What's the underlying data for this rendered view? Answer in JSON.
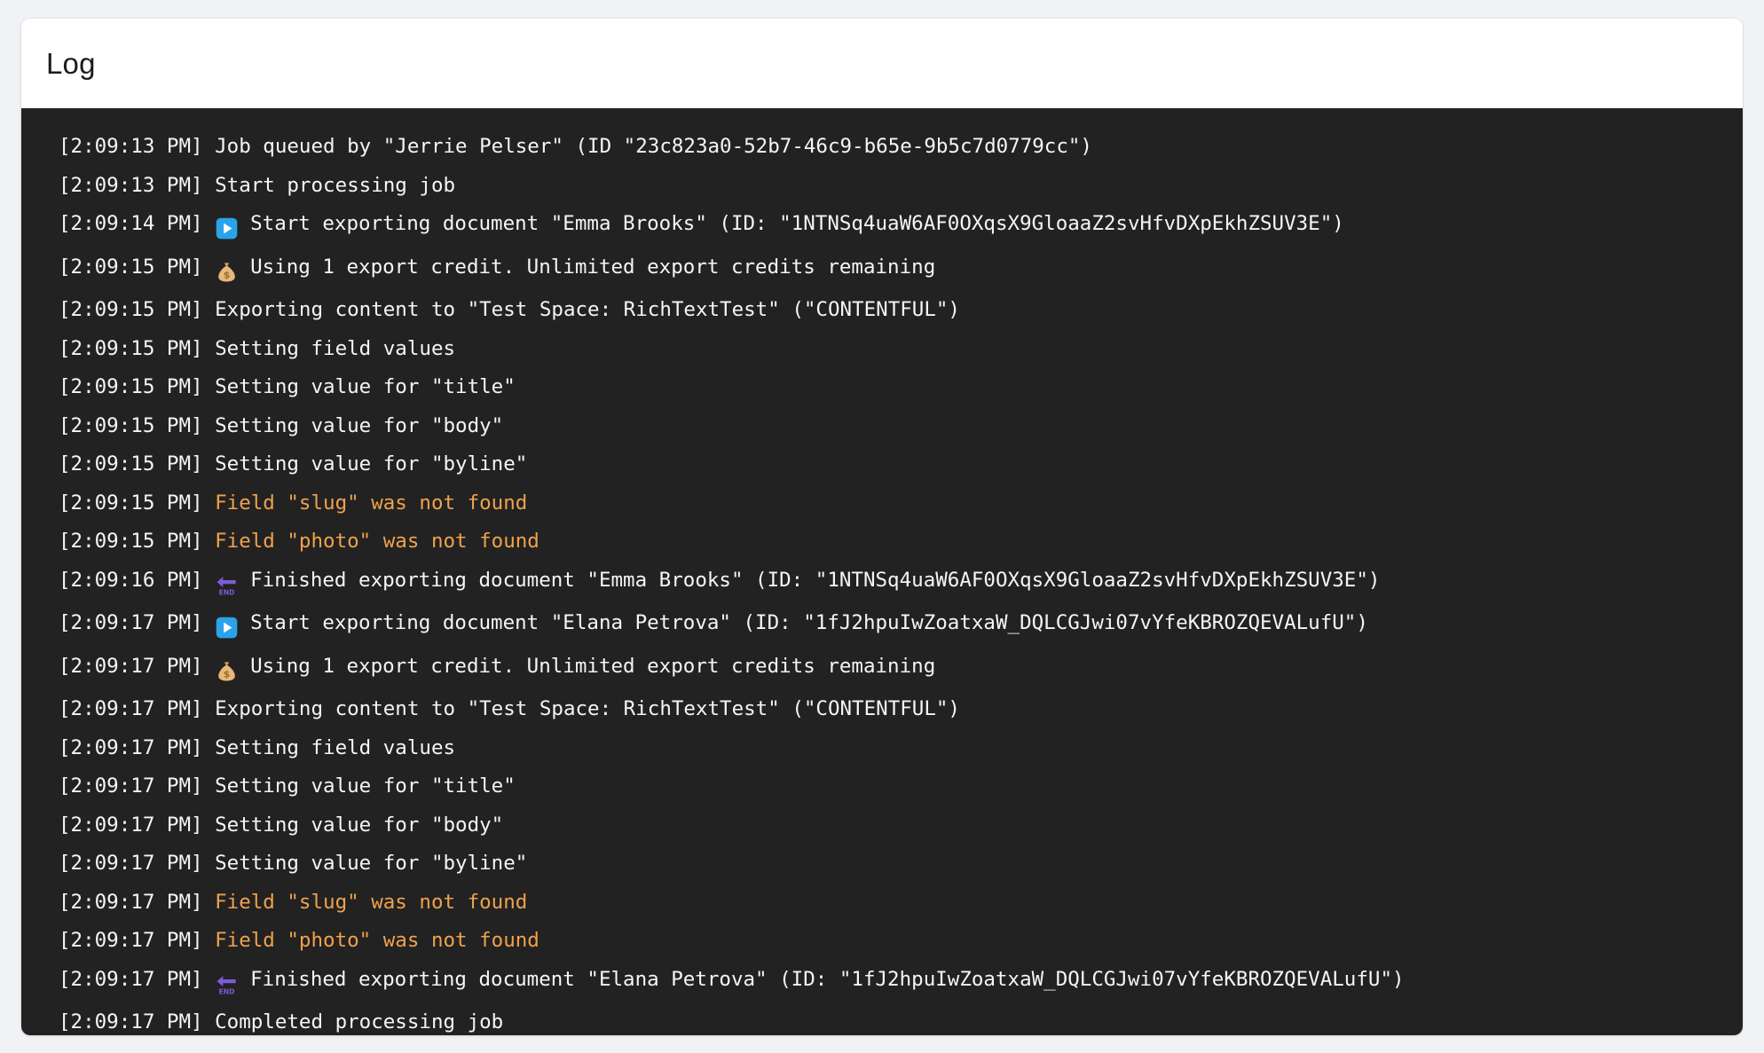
{
  "header": {
    "title": "Log"
  },
  "colors": {
    "page_background": "#f0f2f5",
    "card_background": "#ffffff",
    "console_background": "#222222",
    "text": "#f5f5f5",
    "warning_text": "#f0a24b",
    "play_icon_blue": "#2aa3e8",
    "money_bag_tan": "#e8b878",
    "end_arrow_purple": "#7c5cd6"
  },
  "console": {
    "lines": [
      {
        "timestamp": "[2:09:13 PM]",
        "icon": null,
        "message": "Job queued by \"Jerrie Pelser\" (ID \"23c823a0-52b7-46c9-b65e-9b5c7d0779cc\")",
        "level": "info"
      },
      {
        "timestamp": "[2:09:13 PM]",
        "icon": null,
        "message": "Start processing job",
        "level": "info"
      },
      {
        "timestamp": "[2:09:14 PM]",
        "icon": "play-button-icon",
        "message": "Start exporting document \"Emma Brooks\" (ID: \"1NTNSq4uaW6AF0OXqsX9GloaaZ2svHfvDXpEkhZSUV3E\")",
        "level": "info"
      },
      {
        "timestamp": "[2:09:15 PM]",
        "icon": "money-bag-icon",
        "message": "Using 1 export credit. Unlimited export credits remaining",
        "level": "info"
      },
      {
        "timestamp": "[2:09:15 PM]",
        "icon": null,
        "message": "Exporting content to \"Test Space: RichTextTest\" (\"CONTENTFUL\")",
        "level": "info"
      },
      {
        "timestamp": "[2:09:15 PM]",
        "icon": null,
        "message": "Setting field values",
        "level": "info"
      },
      {
        "timestamp": "[2:09:15 PM]",
        "icon": null,
        "message": "Setting value for \"title\"",
        "level": "info"
      },
      {
        "timestamp": "[2:09:15 PM]",
        "icon": null,
        "message": "Setting value for \"body\"",
        "level": "info"
      },
      {
        "timestamp": "[2:09:15 PM]",
        "icon": null,
        "message": "Setting value for \"byline\"",
        "level": "info"
      },
      {
        "timestamp": "[2:09:15 PM]",
        "icon": null,
        "message": "Field \"slug\" was not found",
        "level": "warn"
      },
      {
        "timestamp": "[2:09:15 PM]",
        "icon": null,
        "message": "Field \"photo\" was not found",
        "level": "warn"
      },
      {
        "timestamp": "[2:09:16 PM]",
        "icon": "end-arrow-icon",
        "message": "Finished exporting document \"Emma Brooks\" (ID: \"1NTNSq4uaW6AF0OXqsX9GloaaZ2svHfvDXpEkhZSUV3E\")",
        "level": "info"
      },
      {
        "timestamp": "[2:09:17 PM]",
        "icon": "play-button-icon",
        "message": "Start exporting document \"Elana Petrova\" (ID: \"1fJ2hpuIwZoatxaW_DQLCGJwi07vYfeKBROZQEVALufU\")",
        "level": "info"
      },
      {
        "timestamp": "[2:09:17 PM]",
        "icon": "money-bag-icon",
        "message": "Using 1 export credit. Unlimited export credits remaining",
        "level": "info"
      },
      {
        "timestamp": "[2:09:17 PM]",
        "icon": null,
        "message": "Exporting content to \"Test Space: RichTextTest\" (\"CONTENTFUL\")",
        "level": "info"
      },
      {
        "timestamp": "[2:09:17 PM]",
        "icon": null,
        "message": "Setting field values",
        "level": "info"
      },
      {
        "timestamp": "[2:09:17 PM]",
        "icon": null,
        "message": "Setting value for \"title\"",
        "level": "info"
      },
      {
        "timestamp": "[2:09:17 PM]",
        "icon": null,
        "message": "Setting value for \"body\"",
        "level": "info"
      },
      {
        "timestamp": "[2:09:17 PM]",
        "icon": null,
        "message": "Setting value for \"byline\"",
        "level": "info"
      },
      {
        "timestamp": "[2:09:17 PM]",
        "icon": null,
        "message": "Field \"slug\" was not found",
        "level": "warn"
      },
      {
        "timestamp": "[2:09:17 PM]",
        "icon": null,
        "message": "Field \"photo\" was not found",
        "level": "warn"
      },
      {
        "timestamp": "[2:09:17 PM]",
        "icon": "end-arrow-icon",
        "message": "Finished exporting document \"Elana Petrova\" (ID: \"1fJ2hpuIwZoatxaW_DQLCGJwi07vYfeKBROZQEVALufU\")",
        "level": "info"
      },
      {
        "timestamp": "[2:09:17 PM]",
        "icon": null,
        "message": "Completed processing job",
        "level": "info"
      }
    ]
  }
}
